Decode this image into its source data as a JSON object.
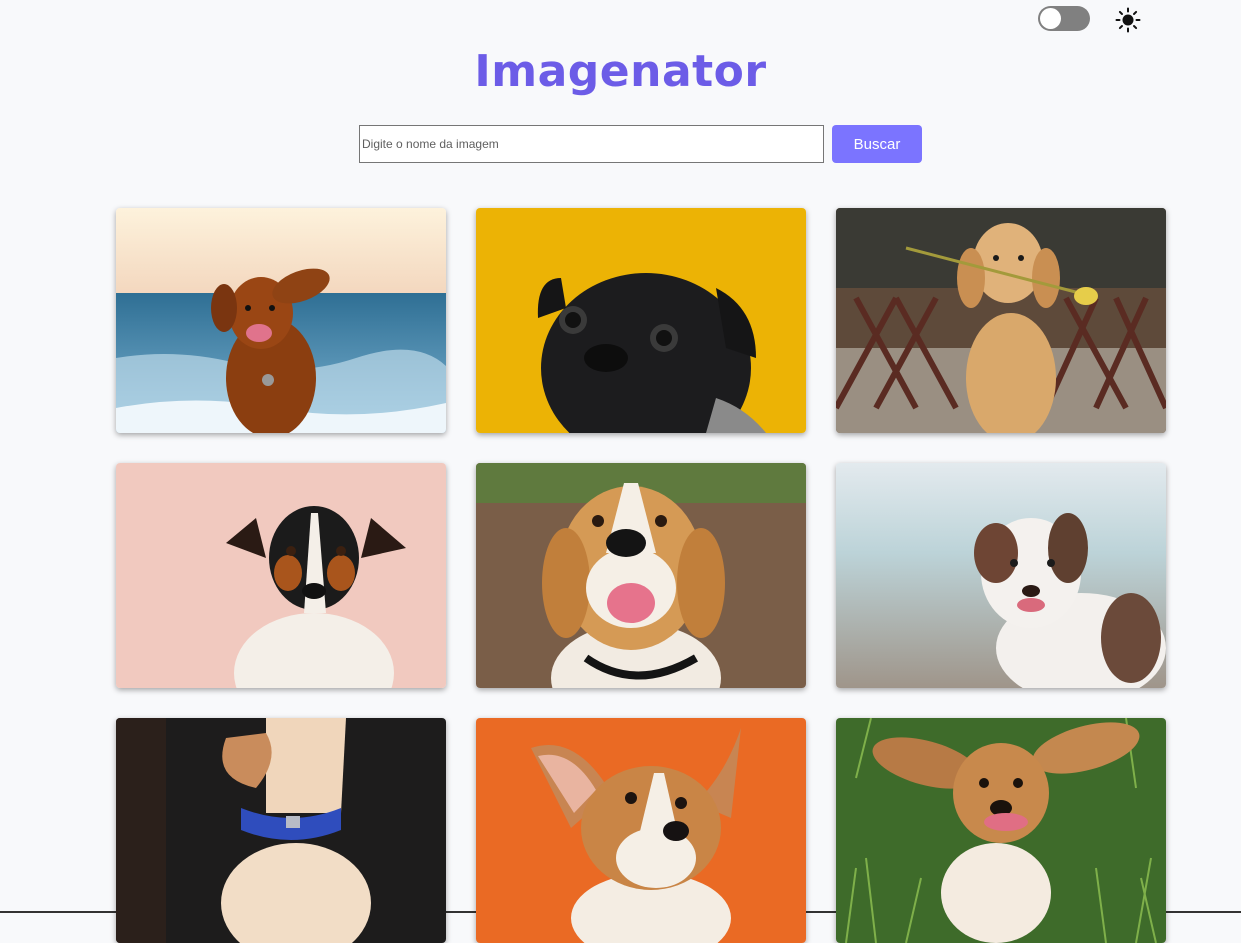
{
  "header": {
    "title": "Imagenator",
    "theme_toggle": {
      "checked": false
    },
    "theme_icon": "sun-icon"
  },
  "search": {
    "placeholder": "Digite o nome da imagem",
    "value": "",
    "button_label": "Buscar"
  },
  "colors": {
    "title": "#6c5ce7",
    "button": "#7b74ff",
    "background": "#f8f9fb"
  },
  "gallery": {
    "images": [
      {
        "subject": "dog-beach-icon"
      },
      {
        "subject": "pug-yellow-icon"
      },
      {
        "subject": "golden-retriever-flower-icon"
      },
      {
        "subject": "jack-russell-pink-icon"
      },
      {
        "subject": "beagle-icon"
      },
      {
        "subject": "australian-shepherd-icon"
      },
      {
        "subject": "dog-blue-collar-icon"
      },
      {
        "subject": "corgi-orange-icon"
      },
      {
        "subject": "spaniel-grass-icon"
      }
    ]
  }
}
